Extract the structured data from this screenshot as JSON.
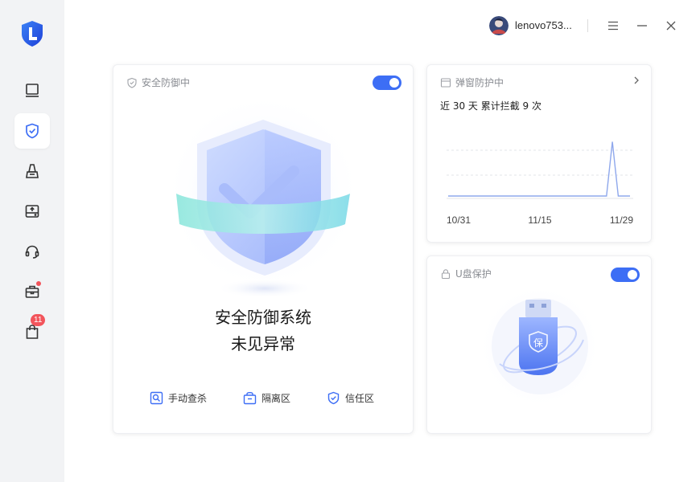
{
  "app": {
    "user": {
      "name": "lenovo753..."
    }
  },
  "nav": [
    {
      "name": "device-icon"
    },
    {
      "name": "shield-check-icon",
      "active": true
    },
    {
      "name": "broom-icon"
    },
    {
      "name": "drive-icon"
    },
    {
      "name": "headset-icon"
    },
    {
      "name": "toolbox-icon",
      "dot": true
    },
    {
      "name": "bag-icon",
      "count": "11"
    }
  ],
  "defense": {
    "title": "安全防御中",
    "enabled": true,
    "status_line1": "安全防御系统",
    "status_line2": "未见异常",
    "actions": [
      {
        "label": "手动查杀",
        "icon": "scan-icon"
      },
      {
        "label": "隔离区",
        "icon": "quarantine-icon"
      },
      {
        "label": "信任区",
        "icon": "trust-shield-icon"
      }
    ]
  },
  "popup": {
    "title": "弹窗防护中",
    "summary": "近 30 天 累计拦截 9 次"
  },
  "usb": {
    "title": "U盘保护",
    "enabled": true,
    "badge_char": "保"
  },
  "chart_data": {
    "type": "line",
    "x_ticks": [
      "10/31",
      "11/15",
      "11/29"
    ],
    "x_start": "10/31",
    "x_end": "12/1",
    "series": [
      {
        "values": [
          0,
          0,
          0,
          0,
          0,
          0,
          0,
          0,
          0,
          0,
          0,
          0,
          0,
          0,
          0,
          0,
          0,
          0,
          0,
          0,
          0,
          0,
          0,
          0,
          0,
          0,
          0,
          0,
          9,
          0,
          0,
          0
        ]
      }
    ],
    "ylim": [
      0,
      10
    ],
    "grid": "horizontal dashed",
    "colors": {
      "line": "#8fa8ec"
    }
  },
  "colors": {
    "accent": "#3d6ef5",
    "badge": "#f2545b"
  }
}
